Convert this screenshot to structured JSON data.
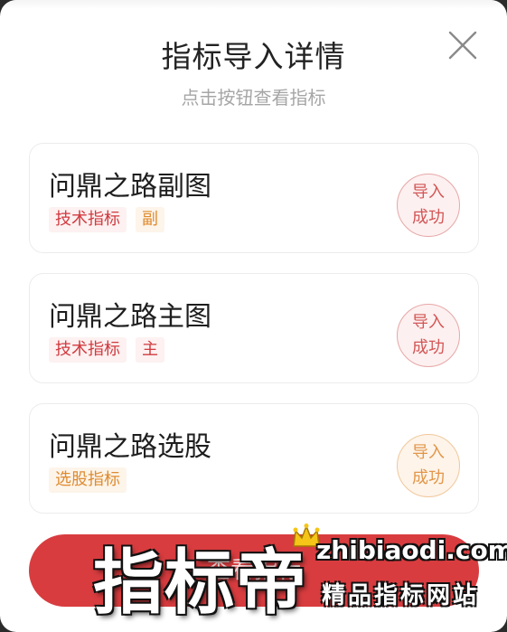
{
  "header": {
    "title": "指标导入详情",
    "subtitle": "点击按钮查看指标"
  },
  "icons": {
    "close": "close-icon"
  },
  "colors": {
    "red": "#d03a3f",
    "orange": "#de8b2f",
    "button": "#d83c3f"
  },
  "cards": [
    {
      "title": "问鼎之路副图",
      "tags": [
        "技术指标",
        "副"
      ],
      "status": [
        "导入",
        "成功"
      ]
    },
    {
      "title": "问鼎之路主图",
      "tags": [
        "技术指标",
        "主"
      ],
      "status": [
        "导入",
        "成功"
      ]
    },
    {
      "title": "问鼎之路选股",
      "tags": [
        "选股指标"
      ],
      "status": [
        "导入",
        "成功"
      ]
    }
  ],
  "footer": {
    "button_label": "查看指标"
  },
  "watermark": {
    "main": "指标帝",
    "site": "zhibiaodi.com",
    "slogan": "精品指标网站"
  }
}
